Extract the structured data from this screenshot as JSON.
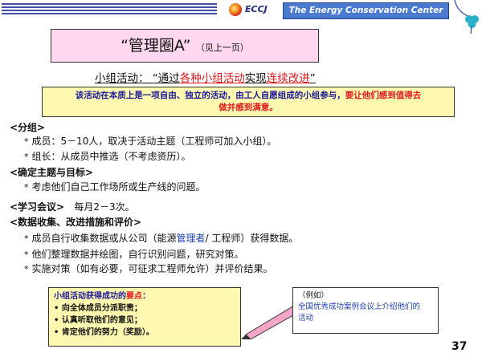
{
  "header": {
    "logo_text": "ECCJ",
    "org_name": "The Energy Conservation Center Japan"
  },
  "title": {
    "main": "“管理圈A”",
    "note": "（见上一页）"
  },
  "subtitle": {
    "prefix": "小组活动： “通过",
    "part1": "各种小组活动",
    "part2": "实现",
    "part3": "连续改进",
    "suffix": "”"
  },
  "note": {
    "line1_blue": "该活动在本质上是一项自由、独立的活动，由工人自愿组成的小组参与，",
    "line1_red": "要让他们感到值得去",
    "line2_red": "做并感到满意。"
  },
  "sections": {
    "grouping": {
      "heading": "<分组>",
      "items": [
        "成员：5－10人，取决于活动主题（工程师可加入小组）。",
        "组长：从成员中推选（不考虑资历）。"
      ]
    },
    "theme": {
      "heading": "<确定主题与目标>",
      "items": [
        "考虑他们自己工作场所或生产线的问题。"
      ]
    },
    "meeting": {
      "heading": "<学习会议>",
      "text": "每月2－3次。"
    },
    "data": {
      "heading": "<数据收集、改进措施和评价>",
      "item1_a": "成员自行收集数据或从公司（能源",
      "item1_b": "管理者",
      "item1_c": "/ 工程师）获得数据。",
      "item2": "他们整理数据并绘图，自行识别问题，研究对策。",
      "item3": "实施对策（如有必要，可征求工程师允许）并评价结果。"
    }
  },
  "success_box": {
    "title_a": "小组活动获得成功的",
    "title_b": "要点",
    "title_c": "：",
    "items": [
      "• 向全体成员分派职责；",
      "• 认真听取他们的意见；",
      "• 肯定他们的努力（奖励）。"
    ]
  },
  "example_box": {
    "label": "（例如）",
    "text_line1": "全国优秀成功案例会议上介绍他们的",
    "text_line2": "活动"
  },
  "page_number": "37"
}
